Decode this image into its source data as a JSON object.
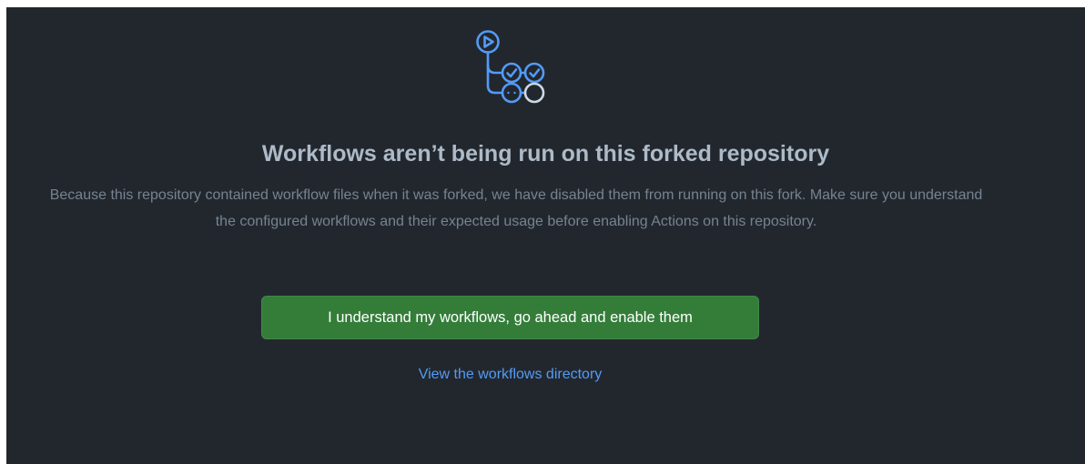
{
  "empty_state": {
    "icon": "workflow-run-icon",
    "accent_color": "#539bf5",
    "title": "Workflows aren’t being run on this forked repository",
    "description": "Because this repository contained workflow files when it was forked, we have disabled them from running on this fork. Make sure you understand the configured workflows and their expected usage before enabling Actions on this repository.",
    "enable_button_label": "I understand my workflows, go ahead and enable them",
    "enable_button_color": "#347d39",
    "view_link_label": "View the workflows directory"
  }
}
